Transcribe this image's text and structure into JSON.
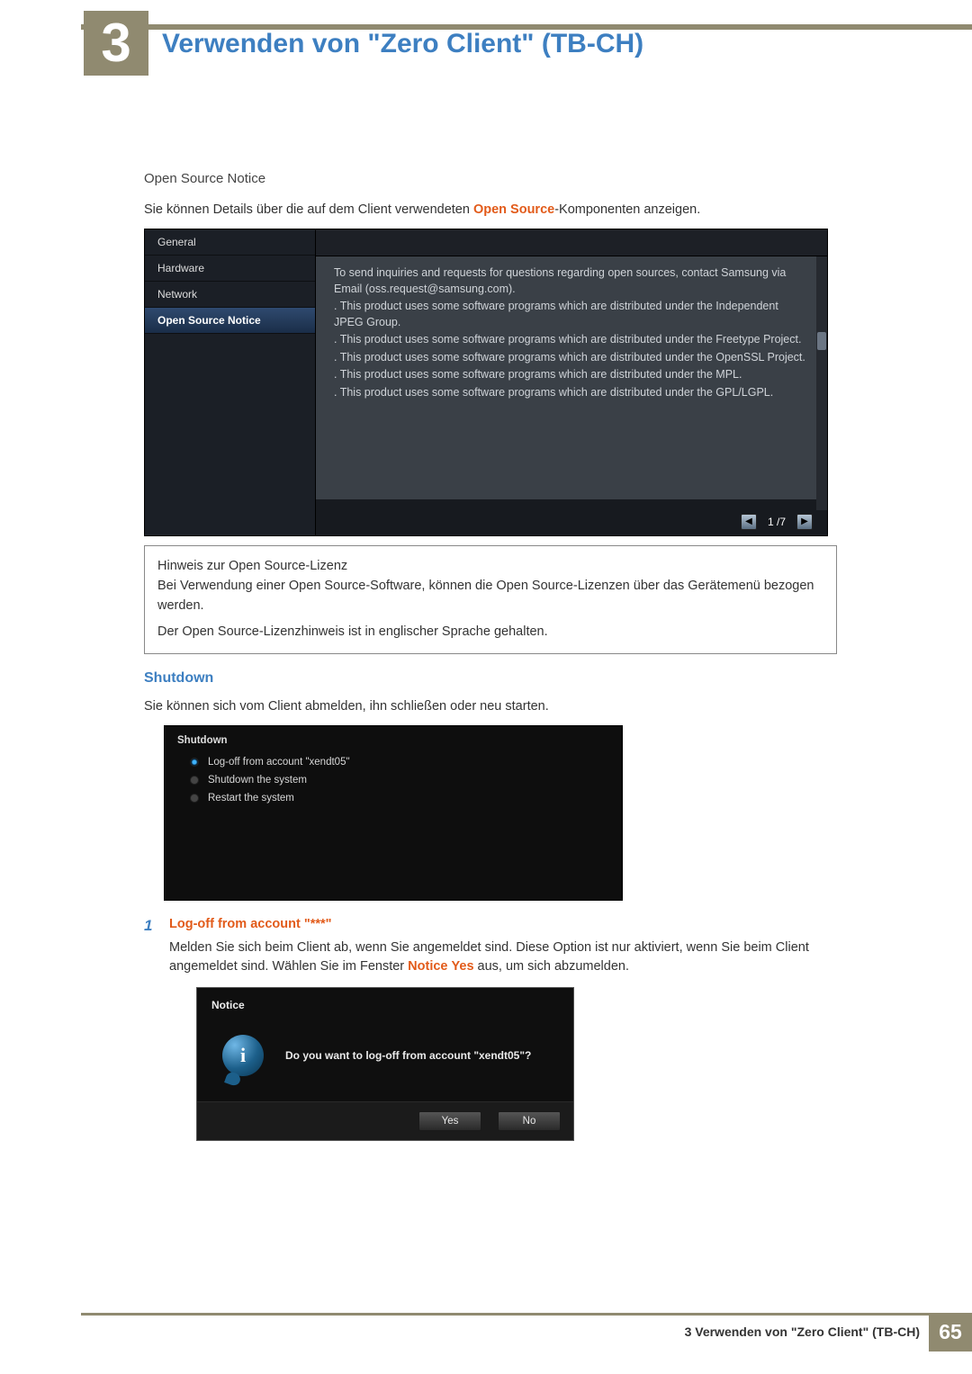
{
  "chapter": {
    "number": "3",
    "title": "Verwenden von \"Zero Client\" (TB-CH)"
  },
  "sec_open_source": {
    "heading": "Open Source Notice",
    "intro_pre": "Sie können Details über die auf dem Client verwendeten ",
    "intro_highlight": "Open Source",
    "intro_post": "-Komponenten anzeigen."
  },
  "shot1": {
    "side": [
      "General",
      "Hardware",
      "Network",
      "Open Source Notice"
    ],
    "side_selected": 3,
    "lines": [
      "To send inquiries and requests for questions regarding open sources, contact Samsung via Email (oss.request@samsung.com).",
      "",
      ". This product uses some software programs which are distributed under the Independent JPEG Group.",
      ". This product uses some software programs which are distributed under the Freetype Project.",
      ". This product uses some software programs which are distributed under the OpenSSL Project.",
      ". This product uses some software programs which are distributed under the MPL.",
      ". This product uses some software programs which are distributed under the GPL/LGPL."
    ],
    "pager": "1 /7",
    "prev": "◀",
    "next": "▶"
  },
  "note": {
    "l1": "Hinweis zur Open Source-Lizenz",
    "l2": "Bei Verwendung einer Open Source-Software, können die Open Source-Lizenzen über das Gerätemenü bezogen werden.",
    "l3": "Der Open Source-Lizenzhinweis ist in englischer Sprache gehalten."
  },
  "sec_shutdown": {
    "heading": "Shutdown",
    "intro": "Sie können sich vom Client abmelden, ihn schließen oder neu starten."
  },
  "shot2": {
    "title": "Shutdown",
    "opts": [
      "Log-off from account \"xendt05\"",
      "Shutdown the system",
      "Restart the system"
    ],
    "selected": 0
  },
  "logoff": {
    "num": "1",
    "heading": "Log-off from account \"***\"",
    "p_pre": "Melden Sie sich beim Client ab, wenn Sie angemeldet sind. Diese Option ist nur aktiviert, wenn Sie beim Client angemeldet sind. Wählen Sie im Fenster ",
    "p_hi1": "Notice",
    "p_mid": " ",
    "p_hi2": "Yes",
    "p_post": " aus, um sich abzumelden."
  },
  "shot3": {
    "title": "Notice",
    "msg": "Do you want to log-off from account \"xendt05\"?",
    "yes": "Yes",
    "no": "No",
    "icon": "i"
  },
  "footer": {
    "text": "3 Verwenden von \"Zero Client\" (TB-CH)",
    "page": "65"
  }
}
